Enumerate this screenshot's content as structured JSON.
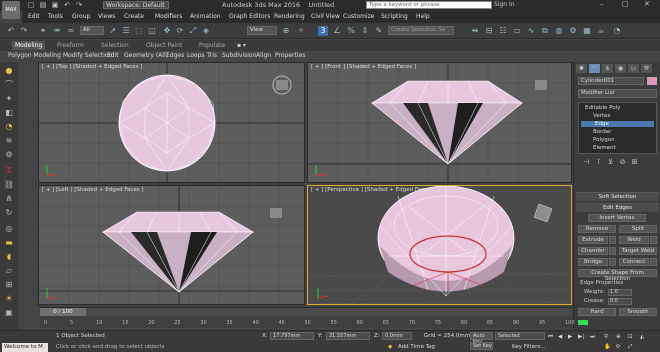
{
  "titlebar": {
    "logo": "MAX",
    "workspace": "Workspace: Default",
    "app": "Autodesk 3ds Max 2016",
    "doc": "Untitled",
    "search_placeholder": "Type a keyword or phrase",
    "signin": "Sign In"
  },
  "menu": [
    "Edit",
    "Tools",
    "Group",
    "Views",
    "Create",
    "Modifiers",
    "Animation",
    "Graph Editors",
    "Rendering",
    "Civil View",
    "Customize",
    "Scripting",
    "Help"
  ],
  "toolbar": {
    "view_dropdown": "View",
    "selection_set": "Create Selection Se"
  },
  "ribbon": {
    "tabs": [
      "Modeling",
      "Freeform",
      "Selection",
      "Object Paint",
      "Populate"
    ],
    "sub": [
      "Polygon Modeling",
      "Modify Selection",
      "Edit",
      "Geometry (All)",
      "Edges",
      "Loops",
      "Tris",
      "Subdivision",
      "Align",
      "Properties"
    ]
  },
  "viewports": {
    "top": "[ + ] [Top ] [Shaded + Edged Faces ]",
    "front": "[ + ] [Front ] [Shaded + Edged Faces ]",
    "left": "[ + ] [Left ] [Shaded + Edged Faces ]",
    "perspective": "[ + ] [Perspective ] [Shaded + Edged Faces ]",
    "sr_badge": "SR"
  },
  "cmd": {
    "object_name": "Cylinder001",
    "modifier_list": "Modifier List",
    "stack": [
      "Editable Poly",
      "Vertex",
      "Edge",
      "Border",
      "Polygon",
      "Element"
    ],
    "soft_selection": "Soft Selection",
    "edit_edges": "Edit Edges",
    "insert_vertex": "Insert Vertex",
    "remove": "Remove",
    "split": "Split",
    "extrude": "Extrude",
    "weld": "Weld",
    "chamfer": "Chamfer",
    "target_weld": "Target Weld",
    "bridge": "Bridge",
    "connect": "Connect",
    "create_shape": "Create Shape From Selection",
    "edge_properties": "Edge Properties",
    "weight_label": "Weight:",
    "weight_value": "1.0",
    "crease_label": "Crease:",
    "crease_value": "0.0",
    "hard": "Hard",
    "smooth": "Smooth"
  },
  "timeline": {
    "handle": "0 / 100",
    "ticks": [
      "0",
      "5",
      "10",
      "15",
      "20",
      "25",
      "30",
      "35",
      "40",
      "45",
      "50",
      "55",
      "60",
      "65",
      "70",
      "75",
      "80",
      "85",
      "90",
      "95",
      "100"
    ]
  },
  "status": {
    "welcome": "Welcome to M",
    "objects": "1 Object Selected",
    "hint": "Click or click-and-drag to select objects",
    "x_label": "X:",
    "x_value": "17.797mm",
    "y_label": "Y:",
    "y_value": "31.557mm",
    "z_label": "Z:",
    "z_value": "0.0mm",
    "grid": "Grid = 254.0mm",
    "auto_key": "Auto Key",
    "selected": "Selected",
    "set_key": "Set Key",
    "key_filters": "Key Filters...",
    "add_time_tag": "Add Time Tag"
  },
  "colors": {
    "object_pink": "#e6c6dc",
    "active_border": "#d8a92a",
    "selection_red": "#cc2b2b"
  }
}
